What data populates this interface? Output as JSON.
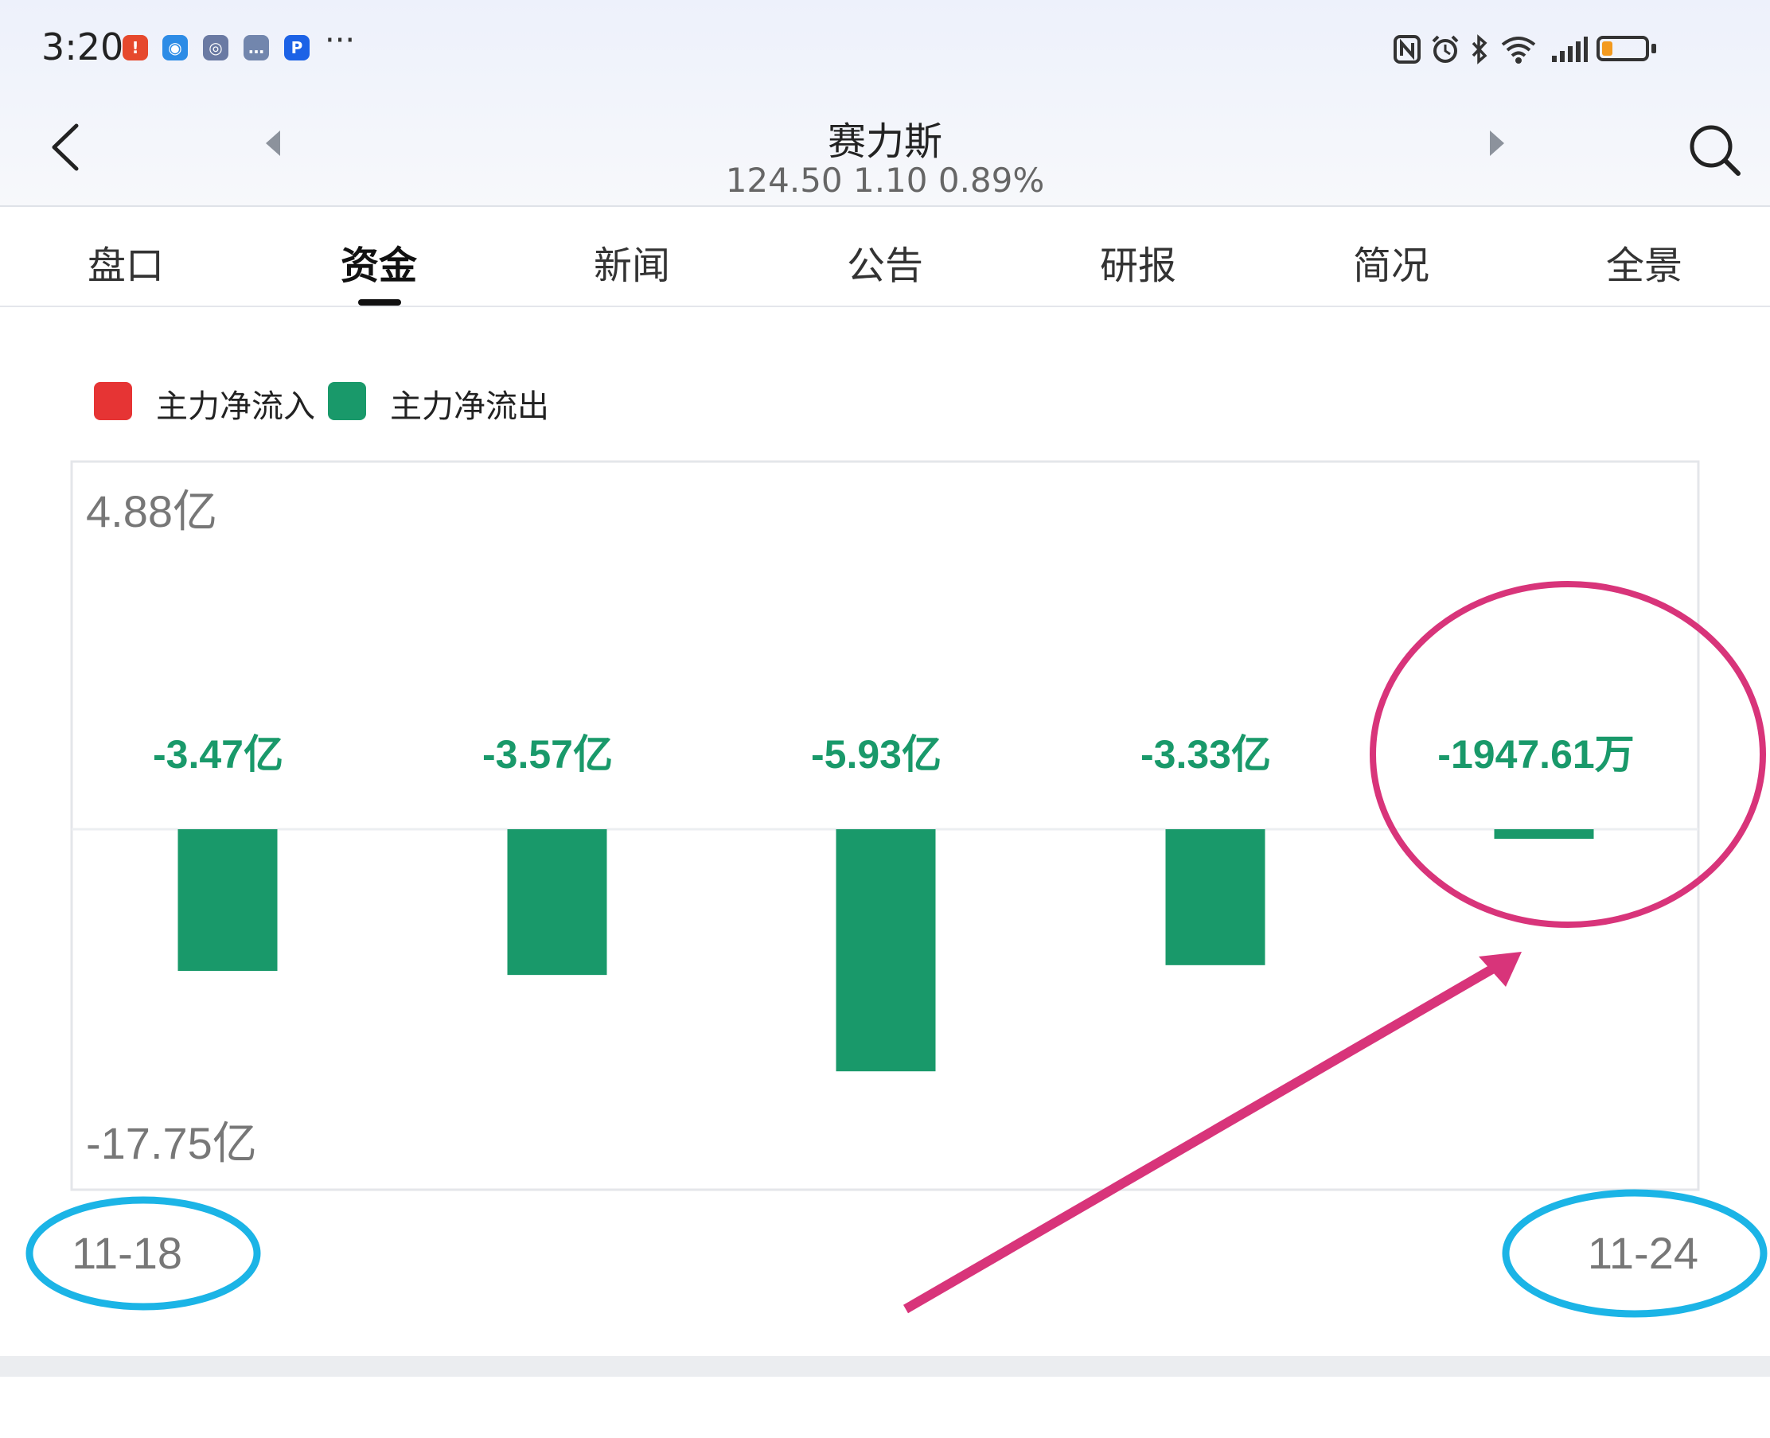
{
  "status_bar": {
    "time": "3:20",
    "more": "···",
    "notification_icons": [
      "alert-app-icon",
      "chat-app-icon",
      "compass-app-icon",
      "message-app-icon",
      "p-app-icon"
    ],
    "system_icons": [
      "nfc-icon",
      "alarm-icon",
      "bluetooth-icon",
      "wifi-icon",
      "signal-icon",
      "battery-icon"
    ],
    "battery_level": 0.22
  },
  "header": {
    "title": "赛力斯",
    "quote": "124.50 1.10 0.89%"
  },
  "tabs": [
    {
      "label": "盘口",
      "active": false
    },
    {
      "label": "资金",
      "active": true
    },
    {
      "label": "新闻",
      "active": false
    },
    {
      "label": "公告",
      "active": false
    },
    {
      "label": "研报",
      "active": false
    },
    {
      "label": "简况",
      "active": false
    },
    {
      "label": "全景",
      "active": false
    }
  ],
  "legend": {
    "inflow_label": "主力净流入",
    "outflow_label": "主力净流出",
    "inflow_color": "#e63434",
    "outflow_color": "#19996a"
  },
  "chart_data": {
    "type": "bar",
    "unit": "亿",
    "values": [
      -3.47,
      -3.57,
      -5.93,
      -3.33,
      -0.194761
    ],
    "value_labels": [
      "-3.47亿",
      "-3.57亿",
      "-5.93亿",
      "-3.33亿",
      "-1947.61万"
    ],
    "ylim": [
      -17.75,
      4.88
    ],
    "ymax_label": "4.88亿",
    "ymin_label": "-17.75亿",
    "x_start_label": "11-18",
    "x_end_label": "11-24"
  },
  "annotations": {
    "circle_color": "#d8347a",
    "date_circle_color": "#1bb4e6"
  }
}
